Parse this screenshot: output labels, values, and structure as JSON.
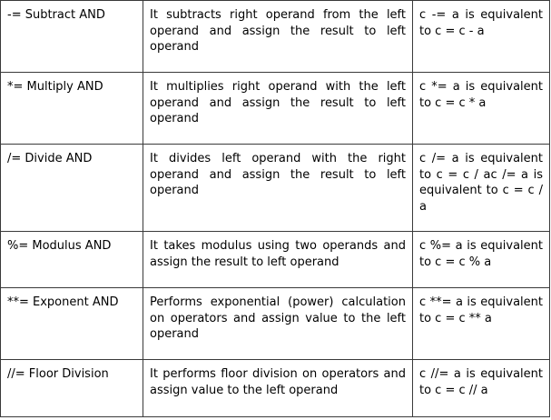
{
  "rows": [
    {
      "operator": "-= Subtract AND",
      "description": "It subtracts right operand from the left operand and assign the result to left operand",
      "example": "c -= a is equivalent to c = c - a"
    },
    {
      "operator": "*= Multiply AND",
      "description": "It multiplies right operand with the left operand and assign the result to left operand",
      "example": "c *= a is equivalent to c = c * a"
    },
    {
      "operator": "/= Divide AND",
      "description": "It divides left operand with the right operand and assign the result to left operand",
      "example": "c /= a is equivalent to c = c / ac /= a is equivalent to c = c / a"
    },
    {
      "operator": "%= Modulus AND",
      "description": "It takes modulus using two operands and assign the result to left operand",
      "example": "c %= a is equivalent to c = c % a"
    },
    {
      "operator": "**= Exponent AND",
      "description": "Performs exponential (power) calculation on operators and assign value to the left operand",
      "example": "c **= a is equivalent to c = c ** a"
    },
    {
      "operator": "//= Floor Division",
      "description": "It performs floor division on operators and assign value to the left operand",
      "example": "c //= a is equivalent to c = c // a"
    }
  ]
}
